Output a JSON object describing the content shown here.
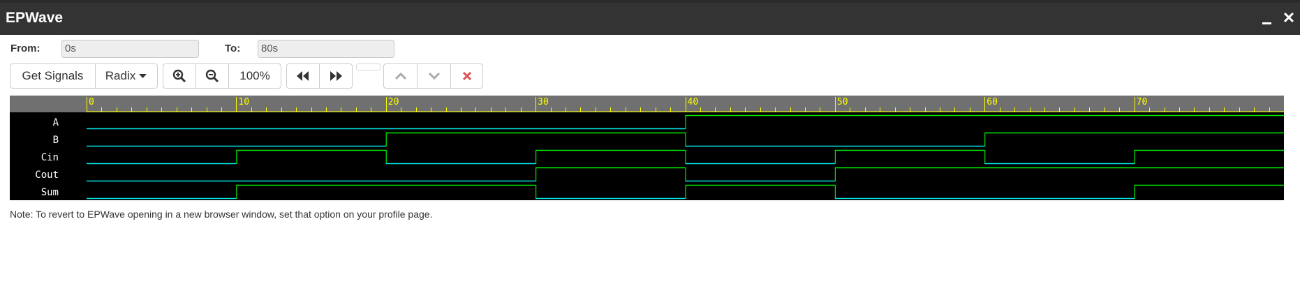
{
  "window": {
    "title": "EPWave",
    "minimize_label": "_",
    "close_label": "✕"
  },
  "range": {
    "from_label": "From:",
    "from_value": "0s",
    "to_label": "To:",
    "to_value": "80s"
  },
  "toolbar": {
    "get_signals_label": "Get Signals",
    "radix_label": "Radix",
    "zoom_in_icon": "zoom-in-icon",
    "zoom_out_icon": "zoom-out-icon",
    "zoom_level": "100%",
    "prev_icon": "fast-backward-icon",
    "next_icon": "fast-forward-icon",
    "up_icon": "chevron-up-icon",
    "down_icon": "chevron-down-icon",
    "remove_icon": "close-icon",
    "remove_color": "#e05050"
  },
  "waveform": {
    "time_start": 0,
    "time_end": 80,
    "tick_labels": [
      "0",
      "10",
      "20",
      "30",
      "40",
      "50",
      "60",
      "70"
    ],
    "colors": {
      "background": "#000000",
      "ruler": "#707070",
      "ruler_text": "#ffff00",
      "signal_low": "#00e5e5",
      "signal_high": "#00ee00",
      "name_text": "#ffffff"
    },
    "signals": [
      {
        "name": "A",
        "transitions": [
          [
            0,
            0
          ],
          [
            40,
            1
          ]
        ]
      },
      {
        "name": "B",
        "transitions": [
          [
            0,
            0
          ],
          [
            20,
            1
          ],
          [
            40,
            0
          ],
          [
            60,
            1
          ]
        ]
      },
      {
        "name": "Cin",
        "transitions": [
          [
            0,
            0
          ],
          [
            10,
            1
          ],
          [
            20,
            0
          ],
          [
            30,
            1
          ],
          [
            40,
            0
          ],
          [
            50,
            1
          ],
          [
            60,
            0
          ],
          [
            70,
            1
          ]
        ]
      },
      {
        "name": "Cout",
        "transitions": [
          [
            0,
            0
          ],
          [
            30,
            1
          ],
          [
            40,
            0
          ],
          [
            50,
            1
          ]
        ]
      },
      {
        "name": "Sum",
        "transitions": [
          [
            0,
            0
          ],
          [
            10,
            1
          ],
          [
            30,
            0
          ],
          [
            40,
            1
          ],
          [
            50,
            0
          ],
          [
            70,
            1
          ]
        ]
      }
    ]
  },
  "footer": {
    "note": "Note: To revert to EPWave opening in a new browser window, set that option on your profile page."
  }
}
